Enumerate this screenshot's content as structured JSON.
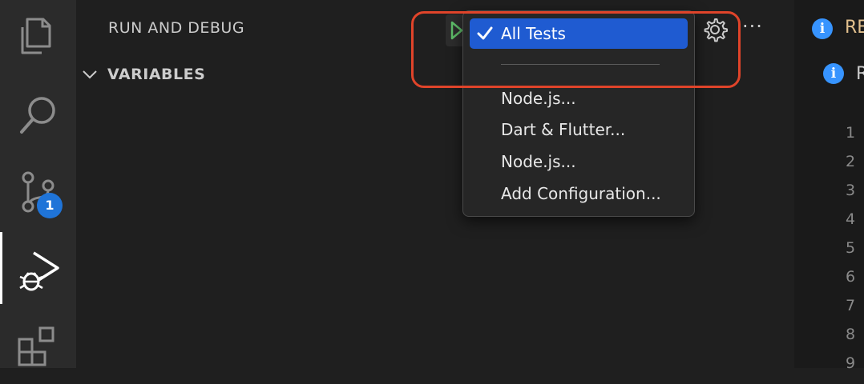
{
  "activity_bar": {
    "items": [
      {
        "icon": "files-icon"
      },
      {
        "icon": "search-icon"
      },
      {
        "icon": "source-control-icon",
        "badge": "1"
      },
      {
        "icon": "run-debug-icon",
        "active": true
      },
      {
        "icon": "extensions-icon"
      }
    ]
  },
  "panel": {
    "title": "RUN AND DEBUG",
    "section": "VARIABLES"
  },
  "dropdown": {
    "items": [
      {
        "label": "All Tests",
        "selected": true
      },
      {
        "label": "Node.js..."
      },
      {
        "label": "Dart & Flutter..."
      },
      {
        "label": "Node.js..."
      },
      {
        "label": "Add Configuration..."
      }
    ]
  },
  "editor": {
    "title_1": "RE",
    "title_2": "R",
    "line_numbers": [
      "1",
      "2",
      "3",
      "4",
      "5",
      "6",
      "7",
      "8",
      "9"
    ]
  },
  "colors": {
    "accent": "#1f5bd1",
    "badge": "#1f74d8",
    "highlight": "#e0442a",
    "info": "#3794ff"
  }
}
